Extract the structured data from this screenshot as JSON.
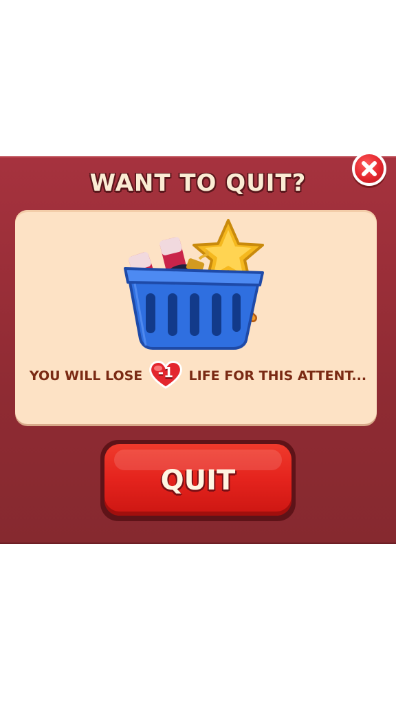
{
  "dialog": {
    "title": "WANT TO QUIT?",
    "message_before": "YOU WILL LOSE",
    "life_change": "-1",
    "message_after": "LIFE FOR THIS ATTENT...",
    "quit_label": "QUIT"
  },
  "icons": {
    "close": "close-icon",
    "heart": "heart-icon",
    "basket": "basket-boosters-icon"
  },
  "colors": {
    "dialog_bg": "#9a2f38",
    "panel_bg": "#fde2c5",
    "title_text": "#fbecd4",
    "message_text": "#7a2a14",
    "quit_button": "#e4231d",
    "close_button": "#e3262e",
    "heart": "#e3262e"
  }
}
